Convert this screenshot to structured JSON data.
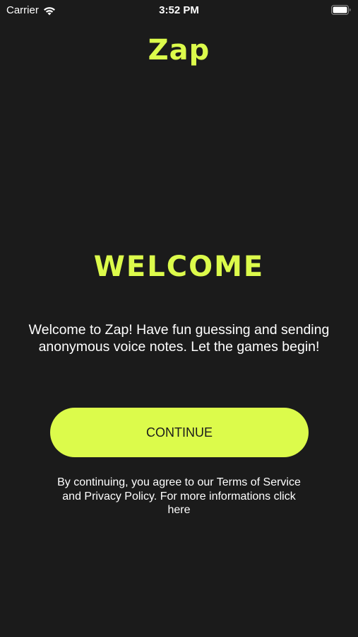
{
  "status_bar": {
    "carrier": "Carrier",
    "time": "3:52 PM"
  },
  "logo": "Zap",
  "title": "WELCOME",
  "welcome_text": "Welcome to Zap! Have fun guessing and sending anonymous voice notes. Let the games begin!",
  "continue_label": "CONTINUE",
  "legal_text": "By continuing, you agree to our Terms of Service and Privacy Policy. For more informations click here",
  "colors": {
    "background": "#1b1b1b",
    "accent": "#dcfb4b",
    "text": "#ffffff",
    "button_text": "#1b1b1b"
  },
  "icons": [
    "wifi-icon",
    "battery-icon"
  ]
}
